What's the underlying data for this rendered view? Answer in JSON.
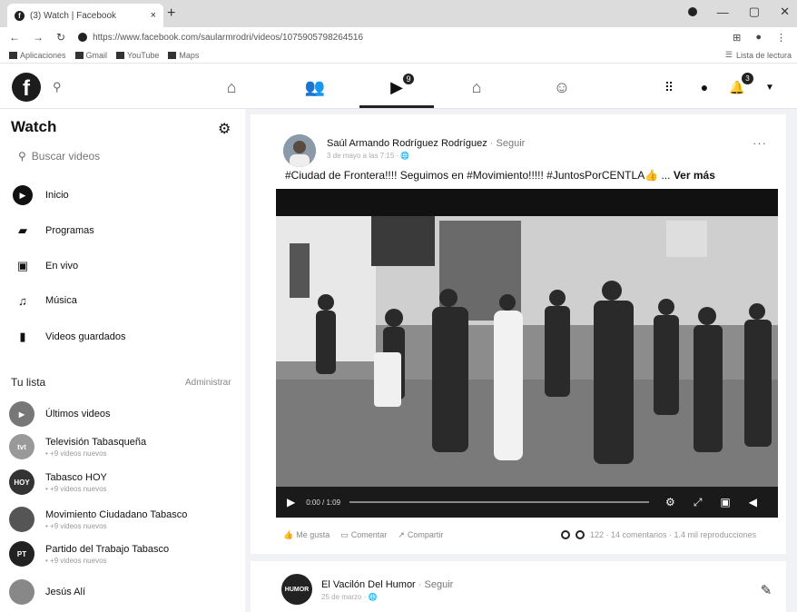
{
  "browser": {
    "tab_title": "(3) Watch | Facebook",
    "tab_close": "×",
    "new_tab": "+",
    "url": "https://www.facebook.com/saularmrodri/videos/1075905798264516",
    "bookmarks": [
      {
        "label": "Aplicaciones",
        "icon": "grid-icon"
      },
      {
        "label": "Gmail",
        "icon": "gmail-icon"
      },
      {
        "label": "YouTube",
        "icon": "youtube-icon"
      },
      {
        "label": "Maps",
        "icon": "maps-icon"
      }
    ],
    "reading_list": "Lista de lectura"
  },
  "fbnav": {
    "logo": "f",
    "watch_badge": "9",
    "notif_badge": "3"
  },
  "sidebar": {
    "title": "Watch",
    "search_placeholder": "Buscar videos",
    "menu": [
      {
        "label": "Inicio",
        "icon": "watch-home-icon"
      },
      {
        "label": "Programas",
        "icon": "shows-icon"
      },
      {
        "label": "En vivo",
        "icon": "live-icon"
      },
      {
        "label": "Música",
        "icon": "music-icon"
      },
      {
        "label": "Videos guardados",
        "icon": "saved-icon"
      }
    ],
    "list_title": "Tu lista",
    "manage": "Administrar",
    "channels": [
      {
        "name": "Últimos videos",
        "sub": ""
      },
      {
        "name": "Televisión Tabasqueña",
        "sub": "• +9 videos nuevos",
        "avatar": "tvt"
      },
      {
        "name": "Tabasco HOY",
        "sub": "• +9 videos nuevos",
        "avatar": "HOY"
      },
      {
        "name": "Movimiento Ciudadano Tabasco",
        "sub": "• +9 videos nuevos",
        "avatar": ""
      },
      {
        "name": "Partido del Trabajo Tabasco",
        "sub": "• +9 videos nuevos",
        "avatar": "PT"
      },
      {
        "name": "Jesús Alí",
        "sub": "",
        "avatar": ""
      }
    ]
  },
  "post": {
    "author": "Saúl Armando Rodríguez Rodríguez",
    "follow": "Seguir",
    "time": "3 de mayo a las 7:15 ·",
    "more_menu": "···",
    "text": "#Ciudad de Frontera!!!! Seguimos en #Movimiento!!!!! #JuntosPorCENTLA👍 ...",
    "see_more": "Ver más",
    "video_time": "0:00 / 1:09",
    "actions": [
      "Me gusta",
      "Comentar",
      "Compartir"
    ],
    "stats": "122 · 14 comentarios · 1.4 mil reproducciones"
  },
  "post2": {
    "author": "El Vacilón Del Humor",
    "follow": "Seguir",
    "time": "25 de marzo ·"
  }
}
